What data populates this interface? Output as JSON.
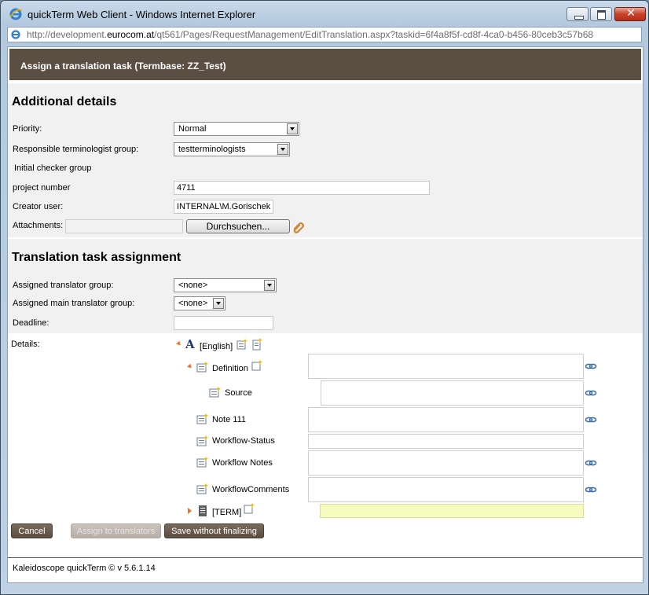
{
  "window": {
    "title": "quickTerm Web Client - Windows Internet Explorer",
    "url_prefix": "http://development.",
    "url_domain": "eurocom.at",
    "url_rest": "/qt561/Pages/RequestManagement/EditTranslation.aspx?taskid=6f4a8f5f-cd8f-4ca0-b456-80ceb3c57b68",
    "close_glyph": "✕"
  },
  "header": {
    "title": "Assign a translation task (Termbase: ZZ_Test)"
  },
  "additional": {
    "heading": "Additional details",
    "priority_label": "Priority:",
    "priority_value": "Normal",
    "resp_group_label": "Responsible terminologist group:",
    "resp_group_value": "testterminologists",
    "checker_label": "Initial checker group",
    "project_label": "project number",
    "project_value": "4711",
    "creator_label": "Creator user:",
    "creator_value": "INTERNAL\\M.Gorischek",
    "attachments_label": "Attachments:",
    "browse_label": "Durchsuchen..."
  },
  "assignment": {
    "heading": "Translation task assignment",
    "translator_label": "Assigned translator group:",
    "translator_value": "<none>",
    "main_translator_label": "Assigned main translator group:",
    "main_translator_value": "<none>",
    "deadline_label": "Deadline:",
    "deadline_value": ""
  },
  "details": {
    "label": "Details:",
    "language": "[English]",
    "fields": [
      "Definition",
      "Source",
      "Note 111",
      "Workflow-Status",
      "Workflow Notes",
      "WorkflowComments"
    ],
    "term": "[TERM]"
  },
  "buttons": {
    "cancel": "Cancel",
    "assign": "Assign to translators",
    "save": "Save without finalizing"
  },
  "footer": {
    "text": "Kaleidoscope quickTerm © v 5.6.1.14"
  },
  "colors": {
    "header_bg": "#5b4e42",
    "button_bg": "#6a5c50",
    "term_field_bg": "#f6fbbf",
    "tree_arrow": "#e8732b"
  }
}
